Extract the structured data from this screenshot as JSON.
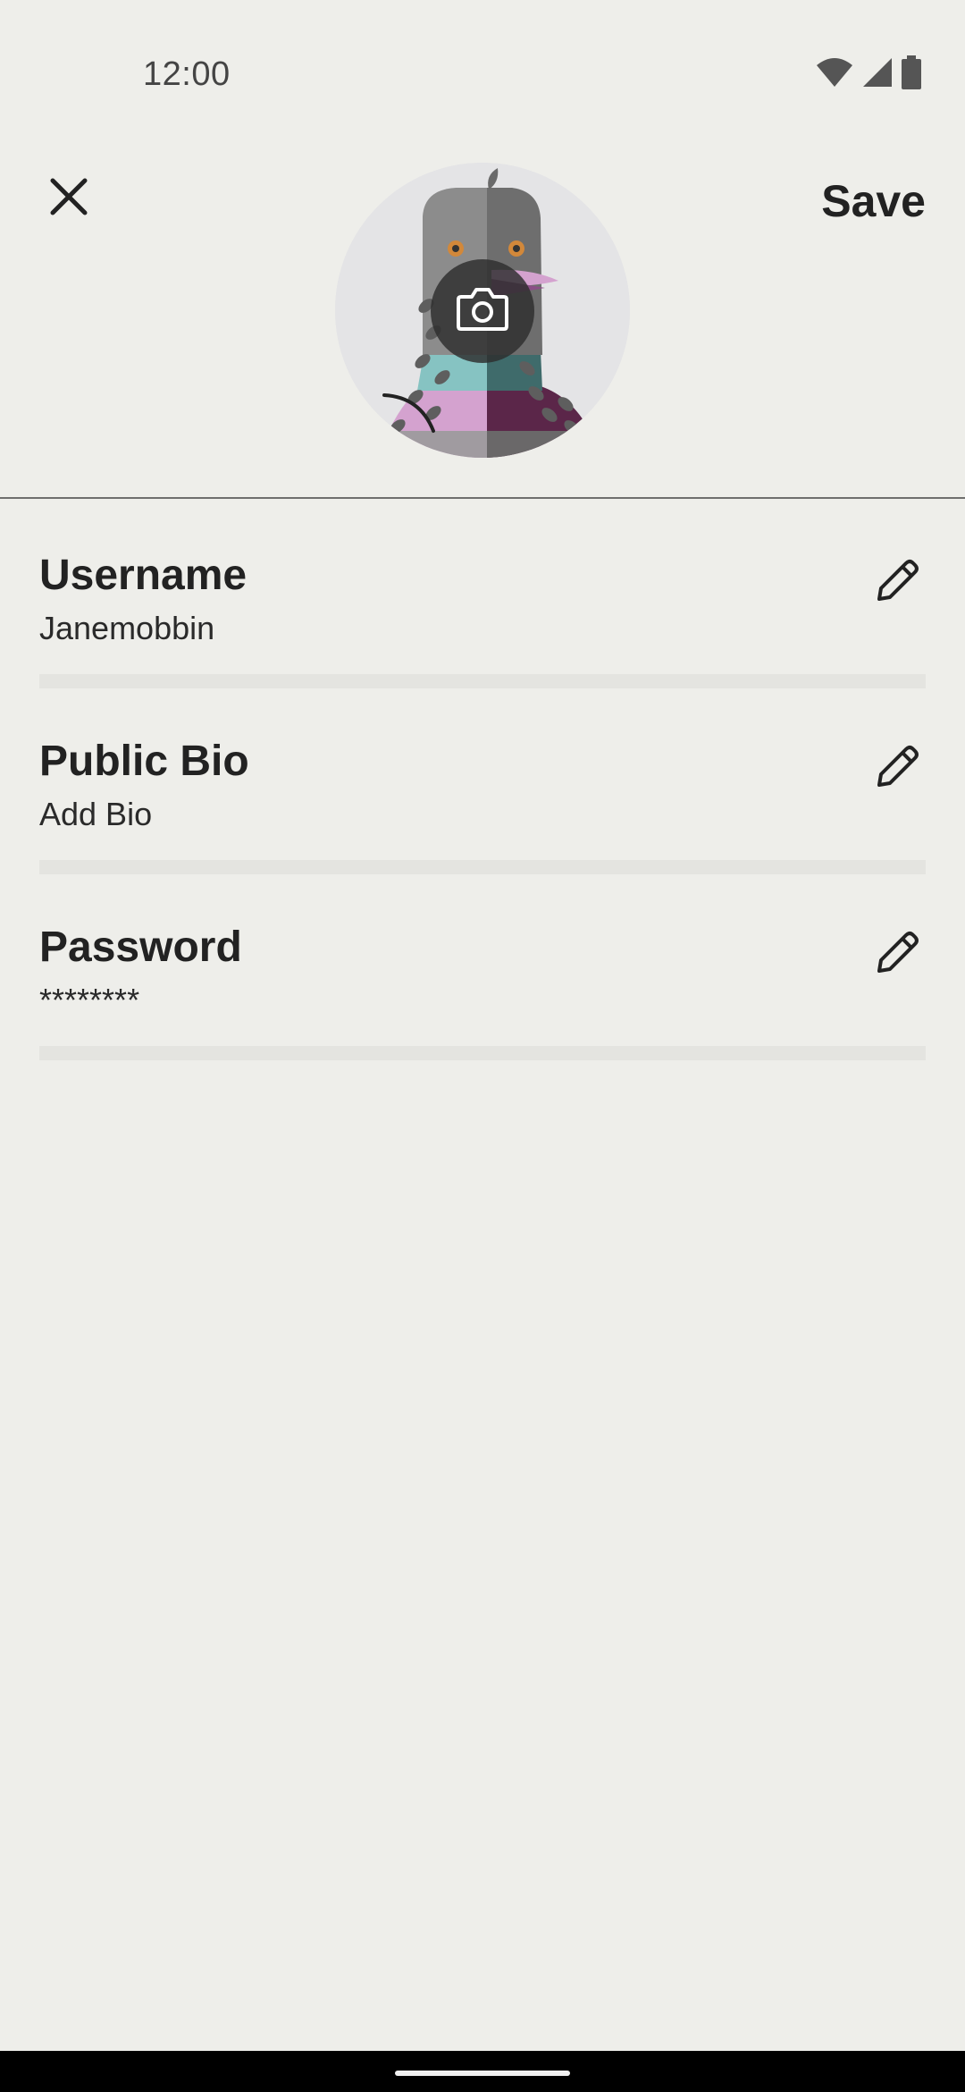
{
  "status_bar": {
    "time": "12:00",
    "icons": [
      "wifi-icon",
      "signal-icon",
      "battery-icon"
    ]
  },
  "header": {
    "close_icon": "close-icon",
    "save_label": "Save",
    "avatar_icon": "pigeon-avatar",
    "camera_icon": "camera-icon"
  },
  "fields": [
    {
      "label": "Username",
      "value": "Janemobbin",
      "edit_icon": "pencil-icon"
    },
    {
      "label": "Public Bio",
      "value": "Add Bio",
      "edit_icon": "pencil-icon"
    },
    {
      "label": "Password",
      "value": "********",
      "edit_icon": "pencil-icon"
    }
  ],
  "colors": {
    "background": "#eeeeea",
    "text": "#222222",
    "divider": "#e4e4e0",
    "header_divider": "#6e6e6e",
    "avatar_bg": "#e4e4e6",
    "avatar_gray": "#8c8c8c",
    "avatar_teal": "#86c3c2",
    "avatar_pink": "#d4a2cf",
    "avatar_plum": "#5b2649",
    "avatar_eye": "#d2883a"
  }
}
